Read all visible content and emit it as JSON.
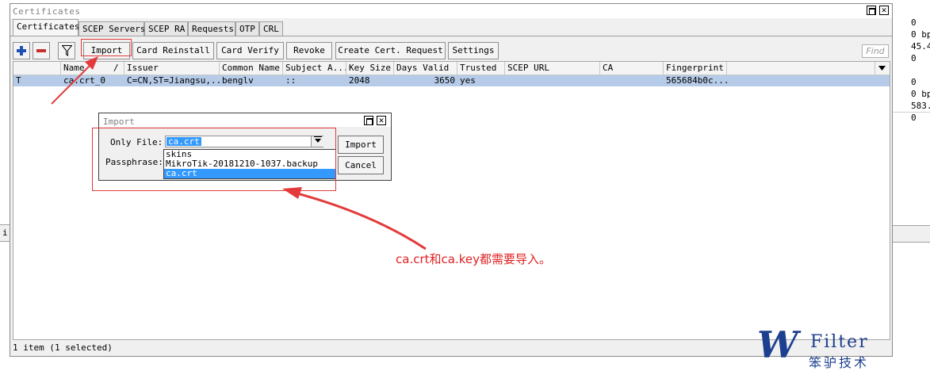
{
  "window": {
    "title": "Certificates"
  },
  "tabs": [
    "Certificates",
    "SCEP Servers",
    "SCEP RA",
    "Requests",
    "OTP",
    "CRL"
  ],
  "toolbar": {
    "buttons": [
      "Import",
      "Card Reinstall",
      "Card Verify",
      "Revoke",
      "Create Cert. Request",
      "Settings"
    ],
    "find_placeholder": "Find",
    "icons": [
      "plus-icon",
      "minus-icon",
      "filter-icon"
    ]
  },
  "table": {
    "columns": [
      "Name",
      "/",
      "Issuer",
      "Common Name",
      "Subject A...",
      "Key Size",
      "Days Valid",
      "Trusted",
      "SCEP URL",
      "CA",
      "Fingerprint"
    ],
    "rows": [
      {
        "flag": "T",
        "name": "ca.crt_0",
        "issuer": "C=CN,ST=Jiangsu,...",
        "common_name": "benglv",
        "subject_alt": "::",
        "key_size": "2048",
        "days_valid": "3650",
        "trusted": "yes",
        "scep_url": "",
        "ca": "",
        "fingerprint": "565684b0c..."
      }
    ]
  },
  "status": "1 item (1 selected)",
  "dialog": {
    "title": "Import",
    "only_file_label": "Only File:",
    "passphrase_label": "Passphrase:",
    "selected_file": "ca.crt",
    "file_options": [
      "skins",
      "MikroTik-20181210-1037.backup",
      "ca.crt"
    ],
    "import_button": "Import",
    "cancel_button": "Cancel"
  },
  "annotation": {
    "note": "ca.crt和ca.key都需要导入。",
    "color": "#e02020"
  },
  "right_panel": {
    "block1": [
      "0",
      "0 bp",
      "45.4",
      "0"
    ],
    "block2": [
      "0",
      "0 bp",
      "583.",
      "0"
    ]
  },
  "left_fragment": "i",
  "logo": {
    "letter": "W",
    "name": "Filter",
    "subtitle": "笨驴技术"
  }
}
